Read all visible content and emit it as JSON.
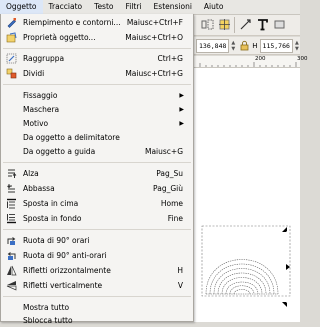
{
  "menubar": {
    "items": [
      {
        "label": "Oggetto"
      },
      {
        "label": "Tracciato"
      },
      {
        "label": "Testo"
      },
      {
        "label": "Filtri"
      },
      {
        "label": "Estensioni"
      },
      {
        "label": "Aiuto"
      }
    ]
  },
  "toolbar": {
    "x_value": "136,848",
    "h_label": "H",
    "h_value": "115,766",
    "ruler_ticks": [
      "200",
      "300"
    ]
  },
  "menu": {
    "items": [
      {
        "label": "Riempimento e contorni...",
        "shortcut": "Maiusc+Ctrl+F",
        "icon": "fill-stroke-icon"
      },
      {
        "label": "Proprietà oggetto...",
        "shortcut": "Maiusc+Ctrl+O",
        "icon": "object-properties-icon"
      },
      {
        "label": "Raggruppa",
        "shortcut": "Ctrl+G",
        "icon": "group-icon"
      },
      {
        "label": "Dividi",
        "shortcut": "Maiusc+Ctrl+G",
        "icon": "ungroup-icon"
      },
      {
        "label": "Fissaggio",
        "shortcut": "",
        "icon": ""
      },
      {
        "label": "Maschera",
        "shortcut": "",
        "icon": ""
      },
      {
        "label": "Motivo",
        "shortcut": "",
        "icon": ""
      },
      {
        "label": "Da oggetto a delimitatore",
        "shortcut": "",
        "icon": ""
      },
      {
        "label": "Da oggetto a guida",
        "shortcut": "Maiusc+G",
        "icon": ""
      },
      {
        "label": "Alza",
        "shortcut": "Pag_Su",
        "icon": "raise-icon"
      },
      {
        "label": "Abbassa",
        "shortcut": "Pag_Giù",
        "icon": "lower-icon"
      },
      {
        "label": "Sposta in cima",
        "shortcut": "Home",
        "icon": "raise-to-top-icon"
      },
      {
        "label": "Sposta in fondo",
        "shortcut": "Fine",
        "icon": "lower-to-bottom-icon"
      },
      {
        "label": "Ruota di 90° orari",
        "shortcut": "",
        "icon": "rotate-cw-icon"
      },
      {
        "label": "Ruota di 90° anti-orari",
        "shortcut": "",
        "icon": "rotate-ccw-icon"
      },
      {
        "label": "Rifletti orizzontalmente",
        "shortcut": "H",
        "icon": "flip-horizontal-icon"
      },
      {
        "label": "Rifletti verticalmente",
        "shortcut": "V",
        "icon": "flip-vertical-icon"
      },
      {
        "label": "Mostra tutto",
        "shortcut": "",
        "icon": ""
      },
      {
        "label": "Sblocca tutto",
        "shortcut": "",
        "icon": ""
      }
    ]
  }
}
